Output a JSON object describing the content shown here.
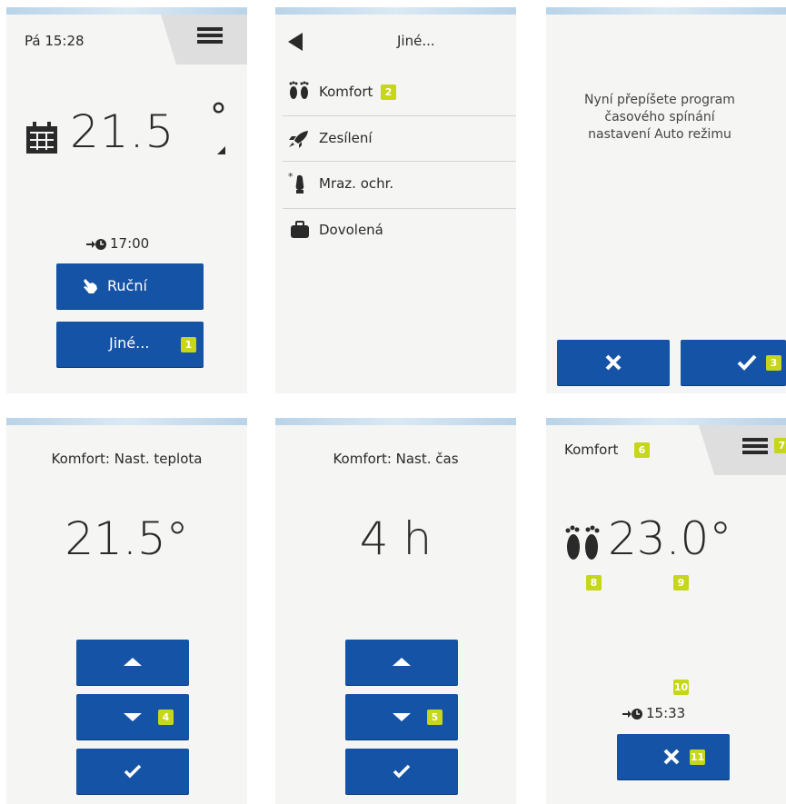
{
  "panel1": {
    "time": "Pá 15:28",
    "temperature": "21.5",
    "temp_unit": "°",
    "next_time": "17:00",
    "btn_manual": "Ruční",
    "btn_other": "Jiné...",
    "badge": "1"
  },
  "panel2": {
    "title": "Jiné...",
    "items": [
      {
        "label": "Komfort",
        "badge": "2"
      },
      {
        "label": "Zesílení"
      },
      {
        "label": "Mraz. ochr."
      },
      {
        "label": "Dovolená"
      }
    ]
  },
  "panel3": {
    "line1": "Nyní přepíšete program",
    "line2": "časového spínání",
    "line3": "nastavení Auto režimu",
    "badge": "3"
  },
  "panel4": {
    "title": "Komfort: Nast. teplota",
    "value": "21.5°",
    "badge": "4"
  },
  "panel5": {
    "title": "Komfort: Nast. čas",
    "value": "4 h",
    "badge": "5"
  },
  "panel6": {
    "title": "Komfort",
    "badge_title": "6",
    "badge_menu": "7",
    "temperature": "23.0°",
    "badge_icon": "8",
    "badge_temp": "9",
    "badge_time": "10",
    "next_time": "15:33",
    "badge_cancel": "11"
  },
  "colors": {
    "button": "#1553a6",
    "badge": "#c6d61a",
    "panel_bg": "#f5f5f3",
    "text": "#2a2a2a"
  }
}
